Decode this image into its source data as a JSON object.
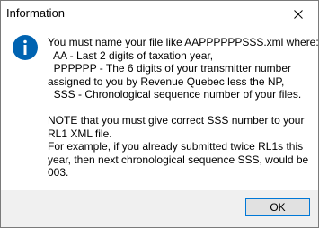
{
  "window": {
    "title": "Information",
    "close_icon": "close-icon"
  },
  "message": {
    "icon": "info-icon",
    "icon_color": "#0063b1",
    "lines": [
      "You must name your file like AAPPPPPPSSS.xml where:",
      "  AA - Last 2 digits of taxation year,",
      "  PPPPPP - The 6 digits of your transmitter number",
      "assigned to you by Revenue Quebec less the NP,",
      "  SSS - Chronological sequence number of your files.",
      "",
      "NOTE that you must give correct SSS number to your",
      "RL1 XML file.",
      "For example, if you already submitted twice RL1s this",
      "year, then next chronological sequence SSS, would be",
      "003."
    ]
  },
  "buttons": {
    "ok_label": "OK",
    "accent": "#0078d7"
  }
}
